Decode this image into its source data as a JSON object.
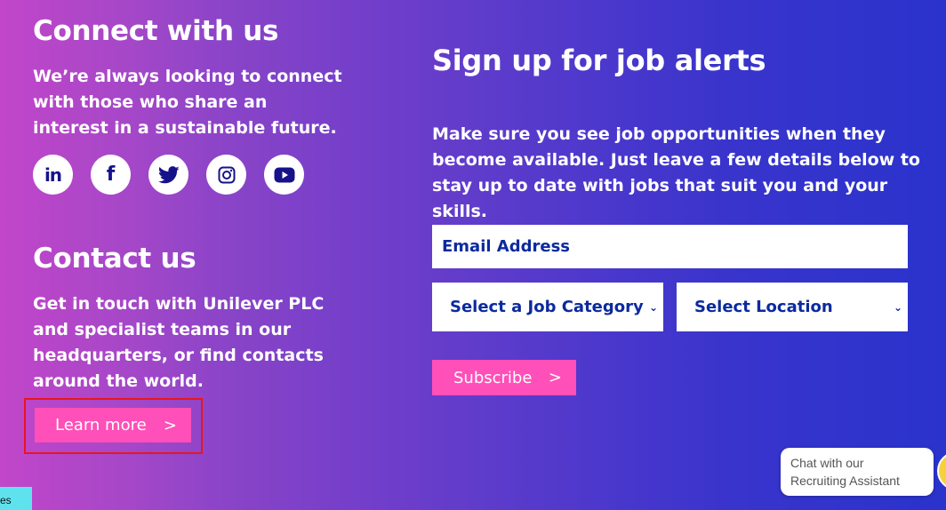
{
  "connect": {
    "title": "Connect with us",
    "text_lines": [
      "We’re always looking to connect",
      "with those who share an",
      "interest in a sustainable future."
    ],
    "social": [
      {
        "name": "linkedin-icon",
        "glyph": "in"
      },
      {
        "name": "facebook-icon",
        "glyph": "f"
      },
      {
        "name": "twitter-icon",
        "glyph": ""
      },
      {
        "name": "instagram-icon",
        "glyph": ""
      },
      {
        "name": "youtube-icon",
        "glyph": ""
      }
    ]
  },
  "contact": {
    "title": "Contact us",
    "text_lines": [
      "Get in touch with Unilever PLC",
      "and specialist teams in our",
      "headquarters, or find contacts",
      "around the world."
    ],
    "learn_more_label": "Learn more",
    "chevron": ">"
  },
  "alerts": {
    "title": "Sign up for job alerts",
    "text_lines": [
      "Make sure you see job opportunities when they",
      "become available. Just leave a few details below to",
      "stay up to date with jobs that suit you and your skills."
    ],
    "email_placeholder": "Email Address",
    "category_selected": "Select a Job Category",
    "location_selected": "Select Location",
    "subscribe_label": "Subscribe",
    "chevron": ">"
  },
  "chat": {
    "line1": "Chat with our",
    "line2": "Recruiting Assistant"
  },
  "cookie_tab": {
    "label": "es"
  },
  "colors": {
    "accent_pink": "#ff4fb8",
    "navy_text": "#0b2a9e",
    "highlight_red": "#e8161c"
  }
}
